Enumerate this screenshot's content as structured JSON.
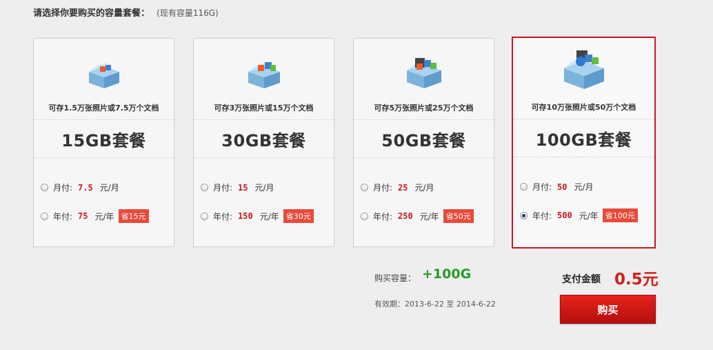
{
  "header": {
    "title": "请选择你要购买的容量套餐：",
    "current_capacity": "(现有容量116G)"
  },
  "plans": [
    {
      "description": "可存1.5万张照片或7.5万个文档",
      "name": "15GB套餐",
      "monthly_label": "月付:",
      "monthly_price": "7.5",
      "monthly_unit": "元/月",
      "yearly_label": "年付:",
      "yearly_price": "75",
      "yearly_unit": "元/年",
      "saving": "省15元",
      "selected_option": "none"
    },
    {
      "description": "可存3万张照片或15万个文档",
      "name": "30GB套餐",
      "monthly_label": "月付:",
      "monthly_price": "15",
      "monthly_unit": "元/月",
      "yearly_label": "年付:",
      "yearly_price": "150",
      "yearly_unit": "元/年",
      "saving": "省30元",
      "selected_option": "none"
    },
    {
      "description": "可存5万张照片或25万个文档",
      "name": "50GB套餐",
      "monthly_label": "月付:",
      "monthly_price": "25",
      "monthly_unit": "元/月",
      "yearly_label": "年付:",
      "yearly_price": "250",
      "yearly_unit": "元/年",
      "saving": "省50元",
      "selected_option": "none"
    },
    {
      "description": "可存10万张照片或50万个文档",
      "name": "100GB套餐",
      "monthly_label": "月付:",
      "monthly_price": "50",
      "monthly_unit": "元/月",
      "yearly_label": "年付:",
      "yearly_price": "500",
      "yearly_unit": "元/年",
      "saving": "省100元",
      "selected_option": "yearly"
    }
  ],
  "summary": {
    "capacity_label": "购买容量：",
    "capacity_value": "+100G",
    "validity": "有效期：2013-6-22 至 2014-6-22",
    "pay_label": "支付金额",
    "pay_value": "0.5元",
    "buy_button": "购买"
  },
  "colors": {
    "accent_red": "#c8161d",
    "saving_badge": "#e84a3c",
    "capacity_green": "#2a9a2a"
  },
  "icons": {
    "package": "package-box-icon"
  }
}
